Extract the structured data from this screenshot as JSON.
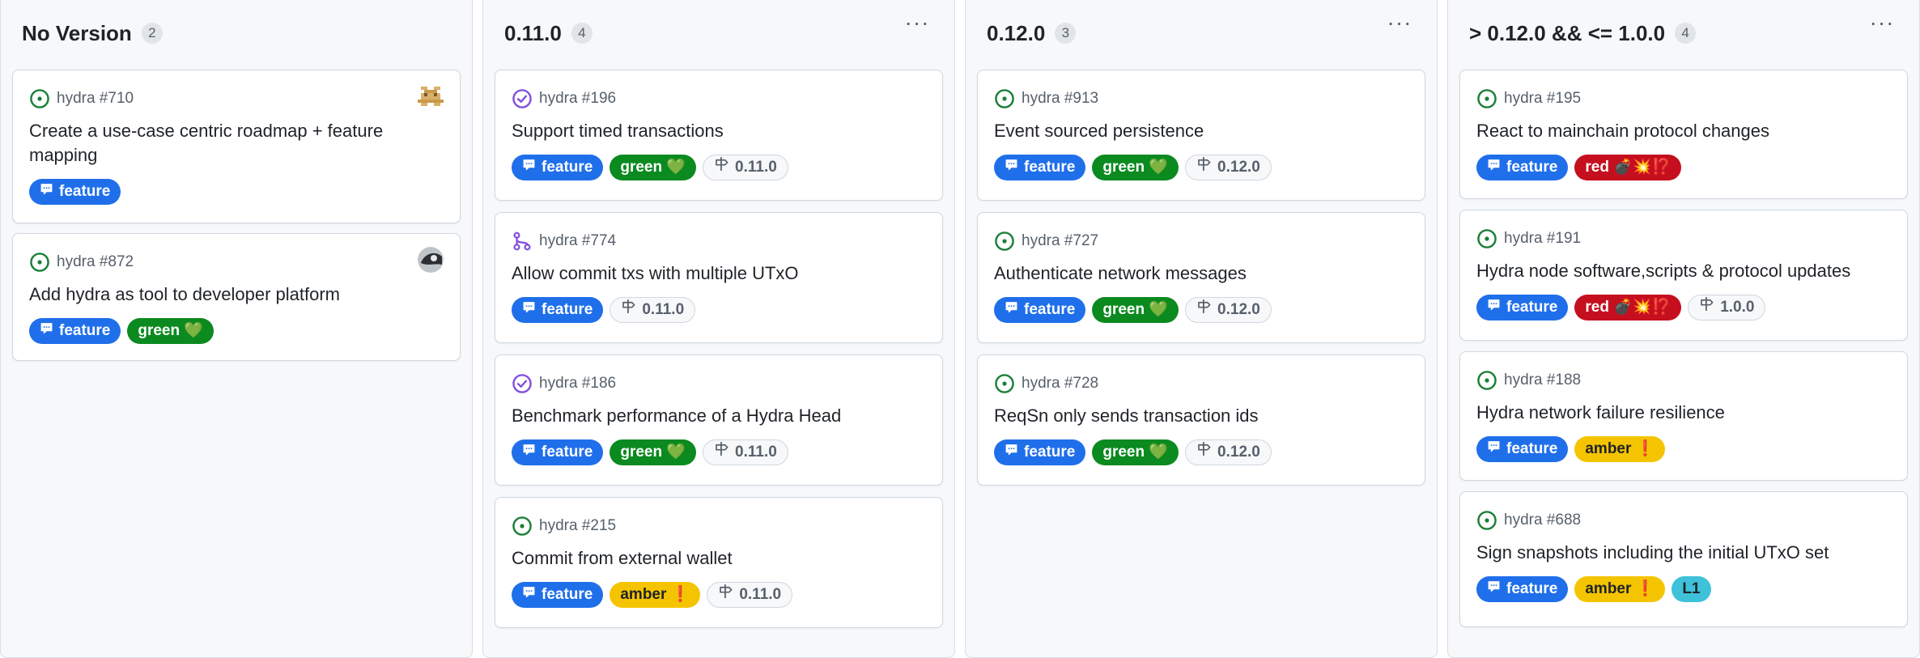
{
  "colors": {
    "open": "#1a7f37",
    "closed": "#8250df",
    "feature": "#1f6feb",
    "green": "#0b8a1f",
    "red": "#c50f1f",
    "amber": "#f5c400",
    "l1": "#3fc1da"
  },
  "columns": [
    {
      "title": "No Version",
      "count": "2",
      "has_menu": false,
      "cards": [
        {
          "repo": "hydra #710",
          "status": "open",
          "title": "Create a use-case centric roadmap + feature mapping",
          "avatar": "pixel-avatar",
          "labels": [
            {
              "kind": "feature",
              "text": "feature",
              "icon": "comment-icon"
            }
          ]
        },
        {
          "repo": "hydra #872",
          "status": "open",
          "title": "Add hydra as tool to developer platform",
          "avatar": "user-avatar",
          "labels": [
            {
              "kind": "feature",
              "text": "feature",
              "icon": "comment-icon"
            },
            {
              "kind": "green",
              "text": "green 💚"
            }
          ]
        }
      ]
    },
    {
      "title": "0.11.0",
      "count": "4",
      "has_menu": true,
      "cards": [
        {
          "repo": "hydra #196",
          "status": "closed",
          "title": "Support timed transactions",
          "labels": [
            {
              "kind": "feature",
              "text": "feature",
              "icon": "comment-icon"
            },
            {
              "kind": "green",
              "text": "green 💚"
            },
            {
              "kind": "milestone",
              "text": "0.11.0",
              "icon": "milestone-icon"
            }
          ]
        },
        {
          "repo": "hydra #774",
          "status": "pr",
          "title": "Allow commit txs with multiple UTxO",
          "labels": [
            {
              "kind": "feature",
              "text": "feature",
              "icon": "comment-icon"
            },
            {
              "kind": "milestone",
              "text": "0.11.0",
              "icon": "milestone-icon"
            }
          ]
        },
        {
          "repo": "hydra #186",
          "status": "closed",
          "title": "Benchmark performance of a Hydra Head",
          "labels": [
            {
              "kind": "feature",
              "text": "feature",
              "icon": "comment-icon"
            },
            {
              "kind": "green",
              "text": "green 💚"
            },
            {
              "kind": "milestone",
              "text": "0.11.0",
              "icon": "milestone-icon"
            }
          ]
        },
        {
          "repo": "hydra #215",
          "status": "open",
          "title": "Commit from external wallet",
          "labels": [
            {
              "kind": "feature",
              "text": "feature",
              "icon": "comment-icon"
            },
            {
              "kind": "amber",
              "text": "amber ❗"
            },
            {
              "kind": "milestone",
              "text": "0.11.0",
              "icon": "milestone-icon"
            }
          ]
        }
      ]
    },
    {
      "title": "0.12.0",
      "count": "3",
      "has_menu": true,
      "cards": [
        {
          "repo": "hydra #913",
          "status": "open",
          "title": "Event sourced persistence",
          "labels": [
            {
              "kind": "feature",
              "text": "feature",
              "icon": "comment-icon"
            },
            {
              "kind": "green",
              "text": "green 💚"
            },
            {
              "kind": "milestone",
              "text": "0.12.0",
              "icon": "milestone-icon"
            }
          ]
        },
        {
          "repo": "hydra #727",
          "status": "open",
          "title": "Authenticate network messages",
          "labels": [
            {
              "kind": "feature",
              "text": "feature",
              "icon": "comment-icon"
            },
            {
              "kind": "green",
              "text": "green 💚"
            },
            {
              "kind": "milestone",
              "text": "0.12.0",
              "icon": "milestone-icon"
            }
          ]
        },
        {
          "repo": "hydra #728",
          "status": "open",
          "title": "ReqSn only sends transaction ids",
          "labels": [
            {
              "kind": "feature",
              "text": "feature",
              "icon": "comment-icon"
            },
            {
              "kind": "green",
              "text": "green 💚"
            },
            {
              "kind": "milestone",
              "text": "0.12.0",
              "icon": "milestone-icon"
            }
          ]
        }
      ]
    },
    {
      "title": "> 0.12.0 && <= 1.0.0",
      "count": "4",
      "has_menu": true,
      "cards": [
        {
          "repo": "hydra #195",
          "status": "open",
          "title": "React to mainchain protocol changes",
          "labels": [
            {
              "kind": "feature",
              "text": "feature",
              "icon": "comment-icon"
            },
            {
              "kind": "red",
              "text": "red 💣💥⁉️"
            }
          ]
        },
        {
          "repo": "hydra #191",
          "status": "open",
          "title": "Hydra node software,scripts & protocol updates",
          "labels": [
            {
              "kind": "feature",
              "text": "feature",
              "icon": "comment-icon"
            },
            {
              "kind": "red",
              "text": "red 💣💥⁉️"
            },
            {
              "kind": "milestone",
              "text": "1.0.0",
              "icon": "milestone-icon"
            }
          ]
        },
        {
          "repo": "hydra #188",
          "status": "open",
          "title": "Hydra network failure resilience",
          "labels": [
            {
              "kind": "feature",
              "text": "feature",
              "icon": "comment-icon"
            },
            {
              "kind": "amber",
              "text": "amber ❗"
            }
          ]
        },
        {
          "repo": "hydra #688",
          "status": "open",
          "title": "Sign snapshots including the initial UTxO set",
          "labels": [
            {
              "kind": "feature",
              "text": "feature",
              "icon": "comment-icon"
            },
            {
              "kind": "amber",
              "text": "amber ❗"
            },
            {
              "kind": "l1",
              "text": "L1"
            }
          ]
        }
      ]
    }
  ]
}
